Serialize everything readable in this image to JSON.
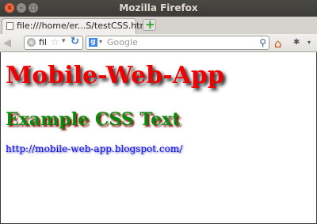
{
  "window": {
    "title": "Mozilla Firefox"
  },
  "tab": {
    "label": "file:///home/er...S/testCSS.html"
  },
  "newtab": {
    "symbol": "+"
  },
  "navbar": {
    "url_text": "fil",
    "search_placeholder": "Google"
  },
  "page": {
    "heading": "Mobile-Web-App",
    "subheading": "Example CSS Text",
    "link": "http://mobile-web-app.blogspot.com/"
  },
  "colors": {
    "heading": "#f00000",
    "subheading": "#0a8a0a",
    "link": "#0000ff"
  }
}
